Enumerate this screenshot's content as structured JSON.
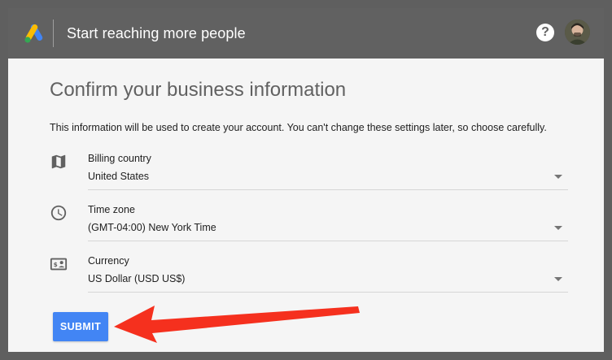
{
  "header": {
    "title": "Start reaching more people",
    "logo_icon": "google-ads-logo",
    "help_icon": "help-icon",
    "help_glyph": "?",
    "avatar_icon": "user-avatar"
  },
  "form": {
    "heading": "Confirm your business information",
    "description": "This information will be used to create your account. You can't change these settings later, so choose carefully.",
    "fields": [
      {
        "icon": "map-icon",
        "label": "Billing country",
        "value": "United States"
      },
      {
        "icon": "clock-icon",
        "label": "Time zone",
        "value": "(GMT-04:00) New York Time"
      },
      {
        "icon": "currency-icon",
        "label": "Currency",
        "value": "US Dollar (USD US$)"
      }
    ],
    "submit_label": "SUBMIT"
  },
  "colors": {
    "accent": "#4285f4",
    "annotation_arrow": "#f5301e",
    "header_bg": "#616161",
    "panel_bg": "#f5f5f5"
  }
}
